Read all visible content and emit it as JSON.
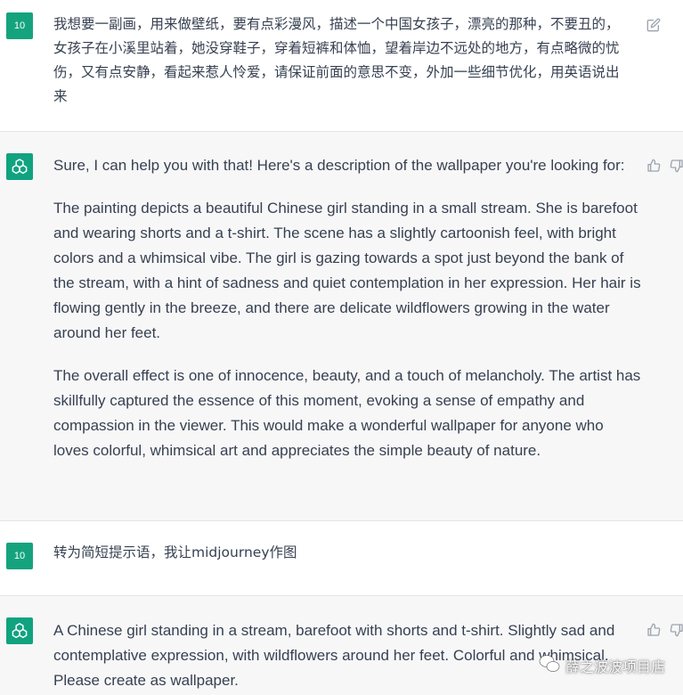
{
  "colors": {
    "brand": "#10a37f",
    "user_avatar_bg": "#15a37e",
    "bot_bg": "#f7f7f8"
  },
  "messages": [
    {
      "role": "user",
      "avatar_text": "10",
      "text": "我想要一副画，用来做壁纸，要有点彩漫风，描述一个中国女孩子，漂亮的那种，不要丑的，女孩子在小溪里站着，她没穿鞋子，穿着短裤和体恤，望着岸边不远处的地方，有点略微的忧伤，又有点安静，看起来惹人怜爱，请保证前面的意思不变，外加一些细节优化，用英语说出来",
      "icon": "edit-icon"
    },
    {
      "role": "assistant",
      "avatar_icon": "openai-logo-icon",
      "paragraphs": [
        "Sure, I can help you with that! Here's a description of the wallpaper you're looking for:",
        "The painting depicts a beautiful Chinese girl standing in a small stream. She is barefoot and wearing shorts and a t-shirt. The scene has a slightly cartoonish feel, with bright colors and a whimsical vibe. The girl is gazing towards a spot just beyond the bank of the stream, with a hint of sadness and quiet contemplation in her expression. Her hair is flowing gently in the breeze, and there are delicate wildflowers growing in the water around her feet.",
        "The overall effect is one of innocence, beauty, and a touch of melancholy. The artist has skillfully captured the essence of this moment, evoking a sense of empathy and compassion in the viewer. This would make a wonderful wallpaper for anyone who loves colorful, whimsical art and appreciates the simple beauty of nature."
      ],
      "icons": [
        "thumbs-up-icon",
        "thumbs-down-icon"
      ]
    },
    {
      "role": "user",
      "avatar_text": "10",
      "text": "转为简短提示语，我让midjourney作图"
    },
    {
      "role": "assistant",
      "avatar_icon": "openai-logo-icon",
      "paragraphs": [
        "A Chinese girl standing in a stream, barefoot with shorts and t-shirt. Slightly sad and contemplative expression, with wildflowers around her feet. Colorful and whimsical. Please create as wallpaper."
      ],
      "icons": [
        "thumbs-up-icon",
        "thumbs-down-icon"
      ]
    }
  ],
  "watermark": {
    "text": "薛之波波项目店",
    "icon": "wechat-icon"
  }
}
